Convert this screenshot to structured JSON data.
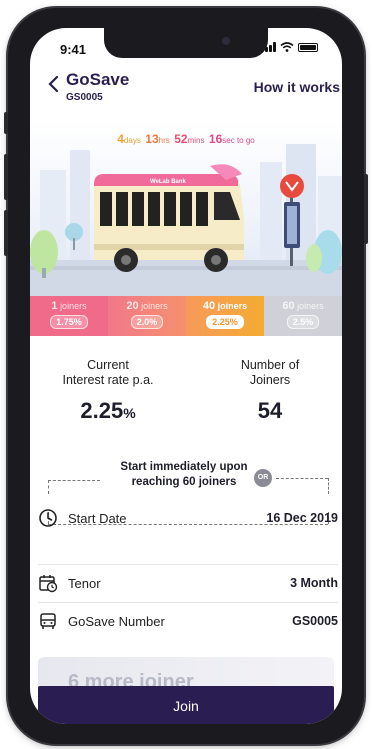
{
  "status": {
    "time": "9:41"
  },
  "header": {
    "title": "GoSave",
    "code": "GS0005",
    "how_it_works": "How it works"
  },
  "countdown": {
    "days": "4",
    "days_unit": "days",
    "hrs": "13",
    "hrs_unit": "hrs",
    "mins": "52",
    "mins_unit": "mins",
    "sec": "16",
    "sec_unit": "sec to go"
  },
  "bus": {
    "brand": "WeLab Bank"
  },
  "tiers": [
    {
      "count": "1",
      "unit": "joiners",
      "rate": "1.75%"
    },
    {
      "count": "20",
      "unit": "joiners",
      "rate": "2.0%"
    },
    {
      "count": "40",
      "unit": "joiners",
      "rate": "2.25%"
    },
    {
      "count": "60",
      "unit": "joiners",
      "rate": "2.5%"
    }
  ],
  "active_tier": 2,
  "stats": {
    "rate_label_1": "Current",
    "rate_label_2": "Interest rate p.a.",
    "rate_value": "2.25",
    "rate_unit": "%",
    "joiners_label_1": "Number of",
    "joiners_label_2": "Joiners",
    "joiners_value": "54"
  },
  "start": {
    "line1": "Start immediately upon",
    "line2": "reaching 60 joiners",
    "or": "OR",
    "date_label": "Start Date",
    "date_value": "16 Dec 2019"
  },
  "details": {
    "tenor_label": "Tenor",
    "tenor_value": "3 Month",
    "number_label": "GoSave Number",
    "number_value": "GS0005"
  },
  "more_banner": "6 more joiner",
  "join_label": "Join",
  "colors": {
    "primary": "#2a1d52",
    "accent_orange": "#f4ab32",
    "accent_pink": "#f06a8a"
  }
}
